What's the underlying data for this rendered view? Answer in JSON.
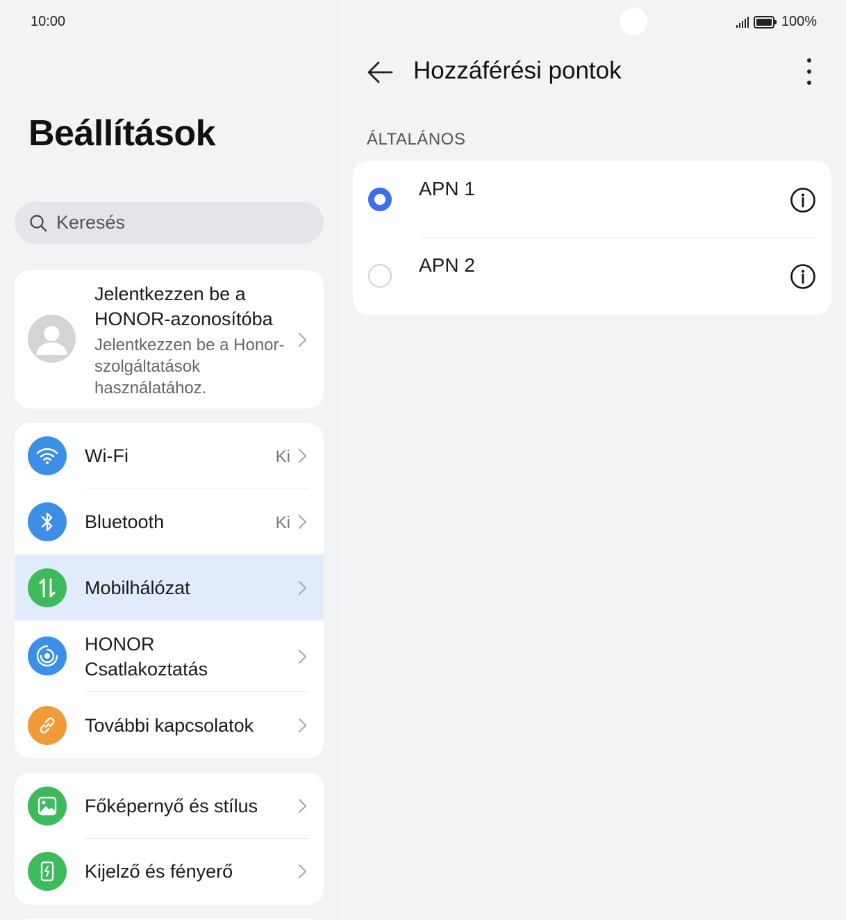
{
  "status_bar": {
    "time": "10:00",
    "battery": "100%"
  },
  "left": {
    "title": "Beállítások",
    "search_placeholder": "Keresés",
    "account": {
      "title": "Jelentkezzen be a HONOR-azonosítóba",
      "subtitle": "Jelentkezzen be a Honor-szolgáltatások használatához."
    },
    "group1": [
      {
        "label": "Wi-Fi",
        "value": "Ki",
        "icon": "wifi-icon",
        "color": "#3d8fe6"
      },
      {
        "label": "Bluetooth",
        "value": "Ki",
        "icon": "bluetooth-icon",
        "color": "#3d8fe6"
      },
      {
        "label": "Mobilhálózat",
        "value": "",
        "icon": "mobile-data-icon",
        "color": "#3dbb5c",
        "selected": true
      },
      {
        "label": "HONOR Csatlakoztatás",
        "value": "",
        "icon": "honor-connect-icon",
        "color": "#3d8fe6"
      },
      {
        "label": "További kapcsolatok",
        "value": "",
        "icon": "link-icon",
        "color": "#f29a38"
      }
    ],
    "group2": [
      {
        "label": "Főképernyő és stílus",
        "icon": "wallpaper-icon",
        "color": "#3dbb5c"
      },
      {
        "label": "Kijelző és fényerő",
        "icon": "display-icon",
        "color": "#3dbb5c"
      }
    ]
  },
  "right": {
    "title": "Hozzáférési pontok",
    "section": "ÁLTALÁNOS",
    "apns": [
      {
        "name": "APN 1",
        "selected": true
      },
      {
        "name": "APN 2",
        "selected": false
      }
    ]
  },
  "colors": {
    "accent": "#3a6ff0",
    "background": "#f1f3f5",
    "highlight": "#e2ebfc"
  }
}
